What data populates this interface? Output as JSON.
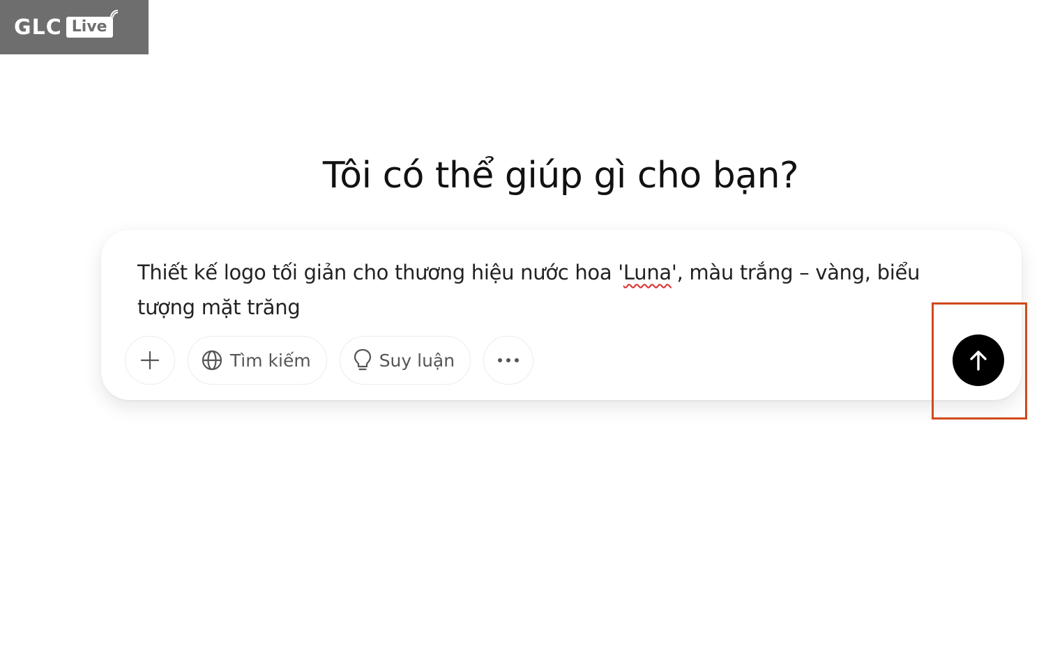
{
  "watermark": {
    "brand": "GLC",
    "badge": "Live"
  },
  "heading": "Tôi có thể giúp gì cho bạn?",
  "composer": {
    "prompt_before": "Thiết kế logo tối giản cho thương hiệu nước hoa '",
    "prompt_misspelled": "Luna",
    "prompt_after": "', màu trắng – vàng, biểu tượng mặt trăng",
    "add_icon": "plus-icon",
    "search_label": "Tìm kiếm",
    "search_icon": "globe-icon",
    "reason_label": "Suy luận",
    "reason_icon": "lightbulb-icon",
    "more_icon": "more-horizontal-icon",
    "send_icon": "arrow-up-icon"
  },
  "colors": {
    "highlight": "#d1491b",
    "send_bg": "#000000",
    "watermark_bg": "#6e6e6e",
    "spell_underline": "#d92c2c"
  }
}
